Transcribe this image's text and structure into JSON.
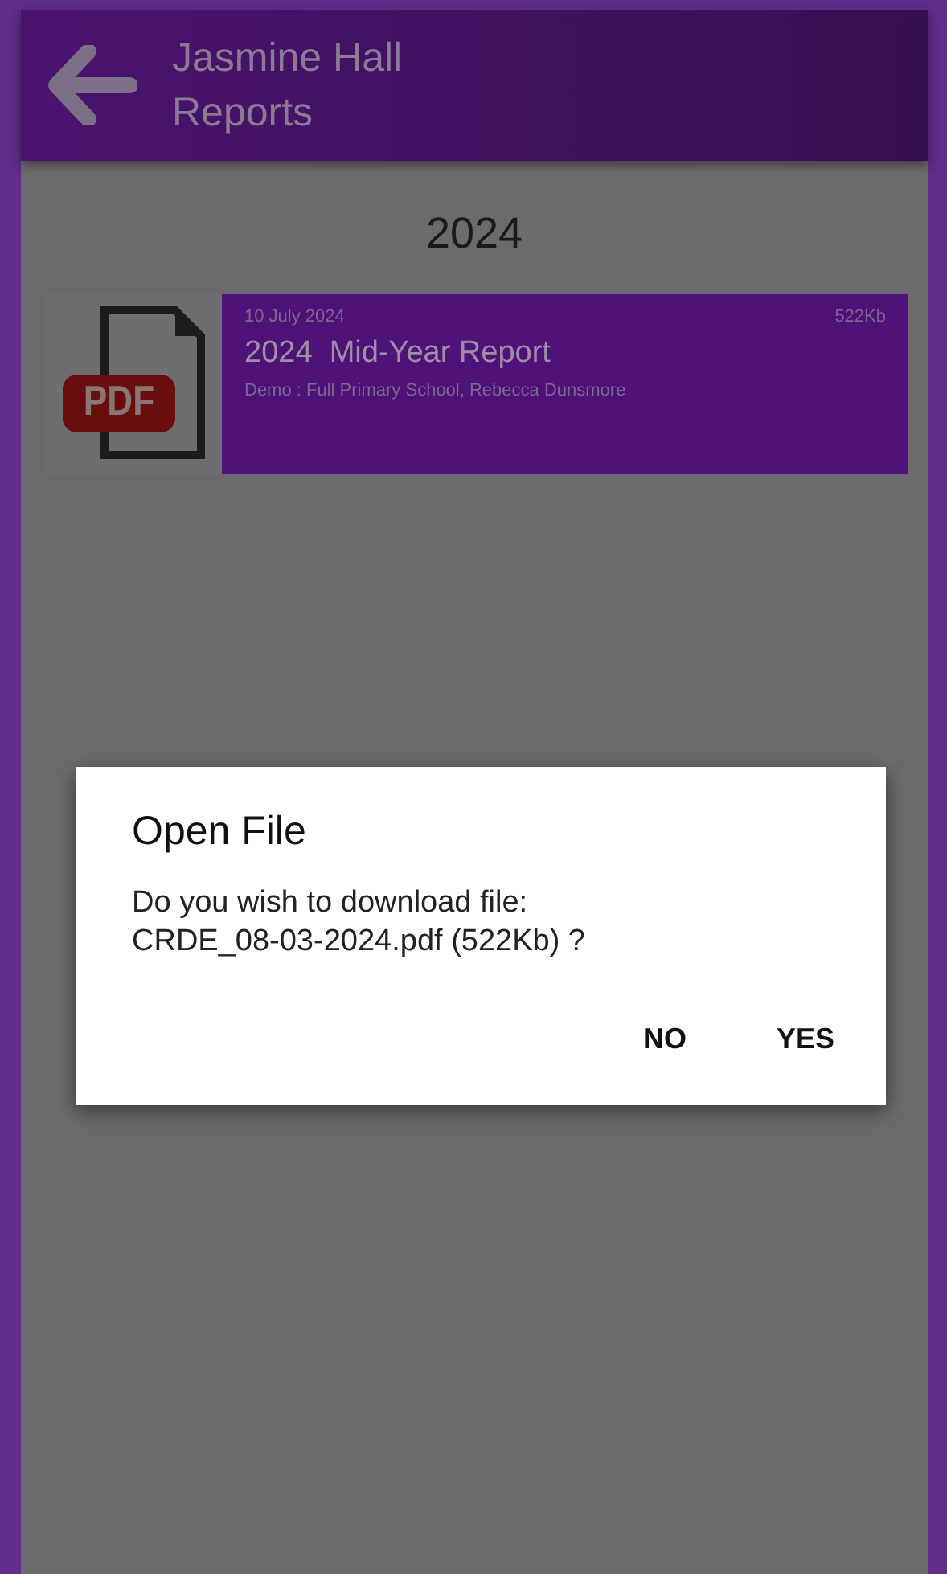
{
  "header": {
    "title": "Jasmine Hall",
    "subtitle": "Reports"
  },
  "year": "2024",
  "reports": [
    {
      "date": "10 July 2024",
      "size": "522Kb",
      "title": "2024  Mid-Year Report",
      "details": "Demo : Full Primary School, Rebecca Dunsmore",
      "file_label": "PDF"
    }
  ],
  "dialog": {
    "title": "Open File",
    "message": "Do you wish to download file:",
    "file": "CRDE_08-03-2024.pdf (522Kb) ?",
    "buttons": [
      "NO",
      "YES"
    ]
  }
}
